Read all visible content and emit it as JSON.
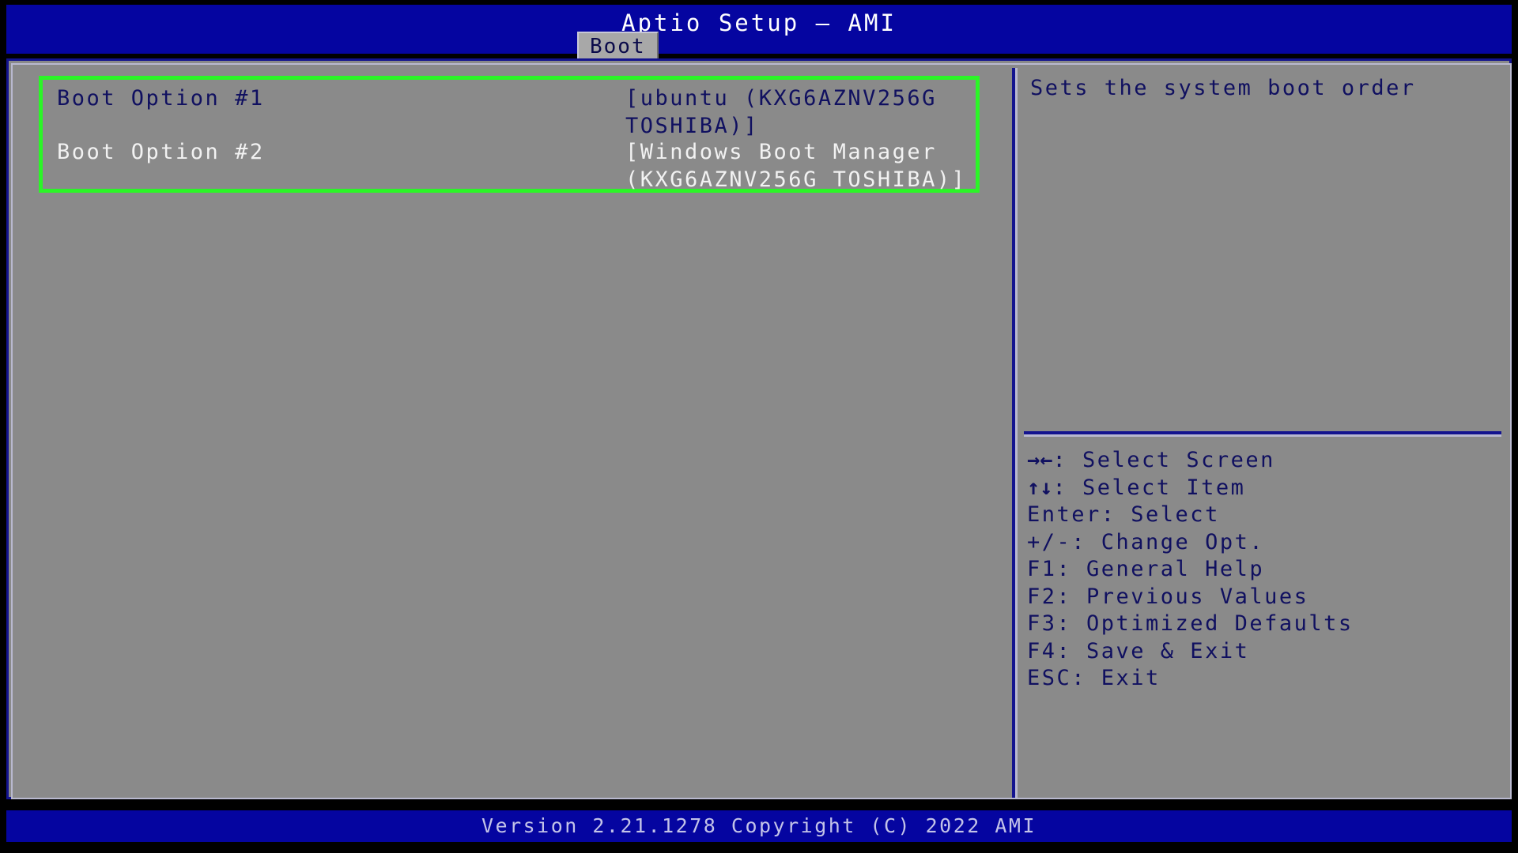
{
  "window": {
    "title": "Aptio Setup – AMI"
  },
  "colors": {
    "header_blue": "#0505a0",
    "body_gray": "#8a8a8a",
    "frame_navy": "#13138f",
    "selection_green": "#2bf527",
    "navy_text": "#101060",
    "white_text": "#f2f2f2",
    "version_text": "#c3c3e8"
  },
  "tabs": [
    {
      "label": "Boot",
      "active": true
    }
  ],
  "settings": {
    "boot_options": [
      {
        "label": "Boot Option #1",
        "value": "[ubuntu (KXG6AZNV256G TOSHIBA)]",
        "selected": true
      },
      {
        "label": "Boot Option #2",
        "value": "[Windows Boot Manager (KXG6AZNV256G TOSHIBA)]",
        "selected": false
      }
    ]
  },
  "help": {
    "description": "Sets the system boot order",
    "keys": [
      {
        "glyph": "→←",
        "text": ": Select Screen"
      },
      {
        "glyph": "↑↓",
        "text": ": Select Item"
      },
      {
        "glyph": "",
        "text": "Enter: Select"
      },
      {
        "glyph": "",
        "text": "+/-: Change Opt."
      },
      {
        "glyph": "",
        "text": "F1: General Help"
      },
      {
        "glyph": "",
        "text": "F2: Previous Values"
      },
      {
        "glyph": "",
        "text": "F3: Optimized Defaults"
      },
      {
        "glyph": "",
        "text": "F4: Save & Exit"
      },
      {
        "glyph": "",
        "text": "ESC: Exit"
      }
    ]
  },
  "footer": {
    "version": "Version 2.21.1278 Copyright (C) 2022 AMI"
  }
}
